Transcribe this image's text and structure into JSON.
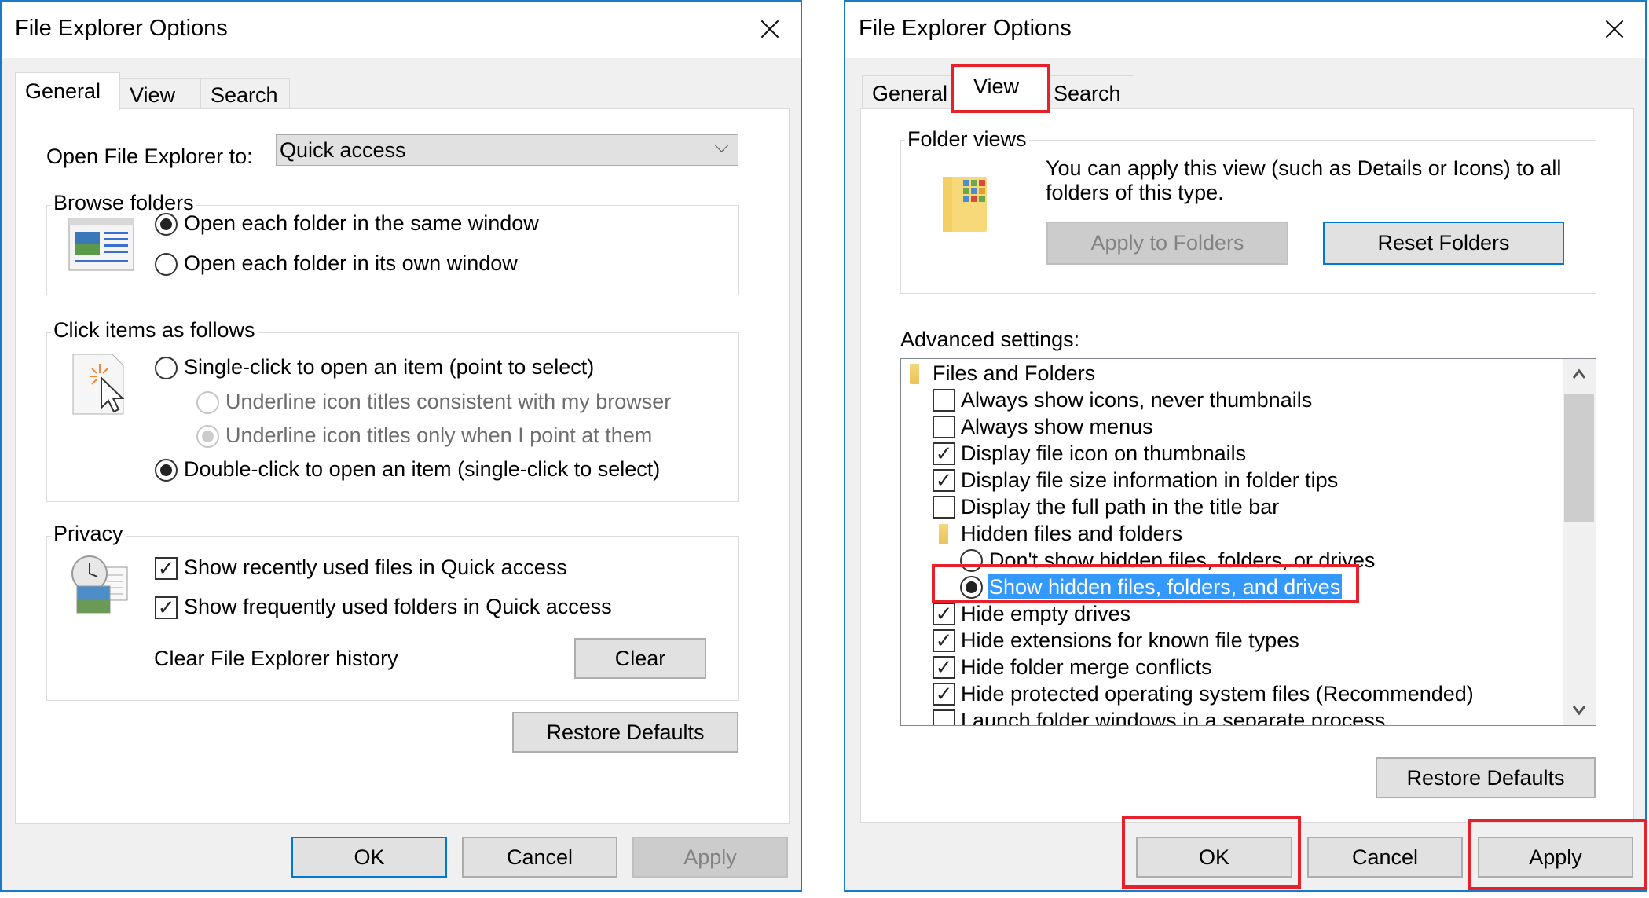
{
  "left_dialog": {
    "title": "File Explorer Options",
    "close_icon": "close-icon",
    "tabs": [
      {
        "label": "General",
        "active": true
      },
      {
        "label": "View",
        "active": false
      },
      {
        "label": "Search",
        "active": false
      }
    ],
    "open_to_label": "Open File Explorer to:",
    "open_to_value": "Quick access",
    "browse_folders": {
      "label": "Browse folders",
      "icon": "window-layout-icon",
      "options": [
        {
          "label": "Open each folder in the same window",
          "selected": true
        },
        {
          "label": "Open each folder in its own window",
          "selected": false
        }
      ]
    },
    "click_items": {
      "label": "Click items as follows",
      "icon": "cursor-click-icon",
      "options": [
        {
          "label": "Single-click to open an item (point to select)",
          "selected": false,
          "disabled": false
        },
        {
          "label": "Underline icon titles consistent with my browser",
          "selected": false,
          "disabled": true
        },
        {
          "label": "Underline icon titles only when I point at them",
          "selected": true,
          "disabled": true
        },
        {
          "label": "Double-click to open an item (single-click to select)",
          "selected": true,
          "disabled": false
        }
      ]
    },
    "privacy": {
      "label": "Privacy",
      "icon": "clock-documents-icon",
      "checkboxes": [
        {
          "label": "Show recently used files in Quick access",
          "checked": true
        },
        {
          "label": "Show frequently used folders in Quick access",
          "checked": true
        }
      ],
      "clear_history_label": "Clear File Explorer history",
      "clear_button": "Clear"
    },
    "restore_defaults": "Restore Defaults",
    "buttons": {
      "ok": "OK",
      "cancel": "Cancel",
      "apply": "Apply"
    }
  },
  "right_dialog": {
    "title": "File Explorer Options",
    "close_icon": "close-icon",
    "tabs": [
      {
        "label": "General",
        "active": false
      },
      {
        "label": "View",
        "active": true
      },
      {
        "label": "Search",
        "active": false
      }
    ],
    "folder_views": {
      "label": "Folder views",
      "icon": "folder-thumbnails-icon",
      "description_line1": "You can apply this view (such as Details or Icons) to all",
      "description_line2": "folders of this type.",
      "apply_to_folders": "Apply to Folders",
      "reset_folders": "Reset Folders"
    },
    "advanced_label": "Advanced settings:",
    "advanced_items": [
      {
        "type": "folder",
        "label": "Files and Folders",
        "indent": 0
      },
      {
        "type": "checkbox",
        "label": "Always show icons, never thumbnails",
        "checked": false,
        "indent": 1
      },
      {
        "type": "checkbox",
        "label": "Always show menus",
        "checked": false,
        "indent": 1
      },
      {
        "type": "checkbox",
        "label": "Display file icon on thumbnails",
        "checked": true,
        "indent": 1
      },
      {
        "type": "checkbox",
        "label": "Display file size information in folder tips",
        "checked": true,
        "indent": 1
      },
      {
        "type": "checkbox",
        "label": "Display the full path in the title bar",
        "checked": false,
        "indent": 1
      },
      {
        "type": "folder",
        "label": "Hidden files and folders",
        "indent": 1
      },
      {
        "type": "radio",
        "label": "Don't show hidden files, folders, or drives",
        "selected": false,
        "indent": 2
      },
      {
        "type": "radio",
        "label": "Show hidden files, folders, and drives",
        "selected": true,
        "highlighted": true,
        "indent": 2
      },
      {
        "type": "checkbox",
        "label": "Hide empty drives",
        "checked": true,
        "indent": 1
      },
      {
        "type": "checkbox",
        "label": "Hide extensions for known file types",
        "checked": true,
        "indent": 1
      },
      {
        "type": "checkbox",
        "label": "Hide folder merge conflicts",
        "checked": true,
        "indent": 1
      },
      {
        "type": "checkbox",
        "label": "Hide protected operating system files (Recommended)",
        "checked": true,
        "indent": 1
      },
      {
        "type": "checkbox",
        "label": "Launch folder windows in a separate process",
        "checked": false,
        "indent": 1
      }
    ],
    "scroll_up_icon": "chevron-up-icon",
    "scroll_down_icon": "chevron-down-icon",
    "restore_defaults": "Restore Defaults",
    "buttons": {
      "ok": "OK",
      "cancel": "Cancel",
      "apply": "Apply"
    }
  },
  "annotations": {
    "color": "#e8202a",
    "highlighted": [
      "View tab",
      "Show hidden files, folders, and drives",
      "OK button",
      "Apply button"
    ]
  },
  "colors": {
    "window_border": "#1979ca",
    "selection": "#3399ff",
    "focus_border": "#0078d7"
  }
}
